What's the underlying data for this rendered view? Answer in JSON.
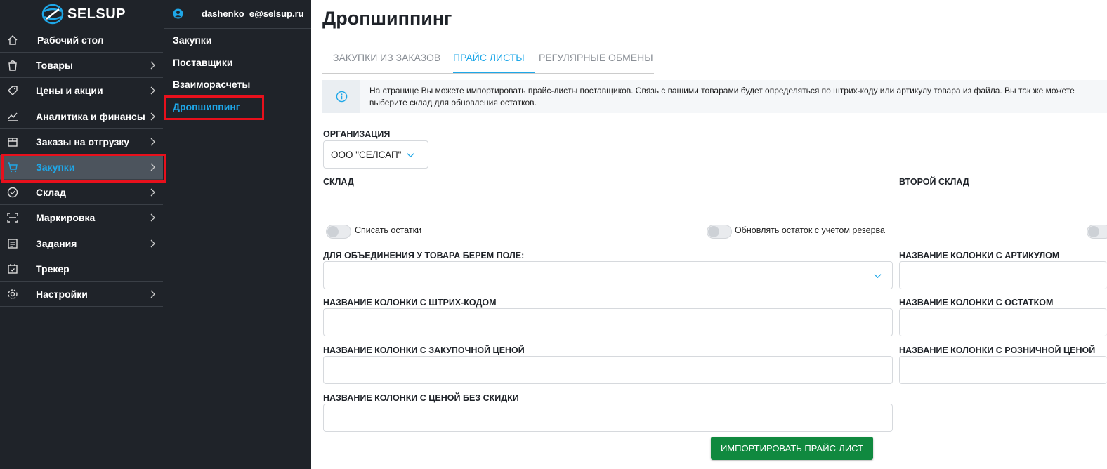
{
  "brand": {
    "logo_text": "SELSUP"
  },
  "user": {
    "email": "dashenko_e@selsup.ru"
  },
  "sidebar": {
    "items": [
      {
        "label": "Рабочий стол",
        "icon": "home-icon"
      },
      {
        "label": "Товары",
        "icon": "bag-icon"
      },
      {
        "label": "Цены и акции",
        "icon": "tag-icon"
      },
      {
        "label": "Аналитика и финансы",
        "icon": "chart-icon"
      },
      {
        "label": "Заказы на отгрузку",
        "icon": "box-icon"
      },
      {
        "label": "Закупки",
        "icon": "cart-icon"
      },
      {
        "label": "Склад",
        "icon": "check-circle-icon"
      },
      {
        "label": "Маркировка",
        "icon": "scan-icon"
      },
      {
        "label": "Задания",
        "icon": "tasks-icon"
      },
      {
        "label": "Трекер",
        "icon": "calendar-check-icon"
      },
      {
        "label": "Настройки",
        "icon": "gear-icon"
      }
    ]
  },
  "submenu": {
    "items": [
      "Закупки",
      "Поставщики",
      "Взаиморасчеты",
      "Дропшиппинг"
    ]
  },
  "main": {
    "title": "Дропшиппинг",
    "tabs": [
      "ЗАКУПКИ ИЗ ЗАКАЗОВ",
      "ПРАЙС ЛИСТЫ",
      "РЕГУЛЯРНЫЕ ОБМЕНЫ"
    ],
    "info": {
      "line1": "На странице Вы можете импортировать прайс-листы поставщиков. Связь с вашими товарами будет определяться по штрих-коду или артикулу товара из файла. Вы так же можете",
      "line2": "выберите склад для обновления остатков."
    },
    "organization_label": "ОРГАНИЗАЦИЯ",
    "organization_value": "ООО \"СЕЛСАП\"",
    "warehouse_label": "СКЛАД",
    "second_warehouse_label": "ВТОРОЙ СКЛАД",
    "toggle_write_off": "Списать остатки",
    "toggle_reserve": "Обновлять остаток с учетом резерва",
    "merge_field_label": "ДЛЯ ОБЪЕДИНЕНИЯ У ТОВАРА БЕРЕМ ПОЛЕ:",
    "article_col_label": "НАЗВАНИЕ КОЛОНКИ С АРТИКУЛОМ",
    "barcode_col_label": "НАЗВАНИЕ КОЛОНКИ С ШТРИХ-КОДОМ",
    "stock_col_label": "НАЗВАНИЕ КОЛОНКИ С ОСТАТКОМ",
    "purchase_price_col_label": "НАЗВАНИЕ КОЛОНКИ С ЗАКУПОЧНОЙ ЦЕНОЙ",
    "retail_price_col_label": "НАЗВАНИЕ КОЛОНКИ С РОЗНИЧНОЙ ЦЕНОЙ",
    "no_discount_col_label": "НАЗВАНИЕ КОЛОНКИ С ЦЕНОЙ БЕЗ СКИДКИ",
    "import_button": "ИМПОРТИРОВАТЬ ПРАЙС-ЛИСТ"
  },
  "colors": {
    "accent": "#1ea7e8",
    "sidebar_bg": "#1f2329",
    "highlight": "#e8101c",
    "button_green": "#10893f"
  }
}
